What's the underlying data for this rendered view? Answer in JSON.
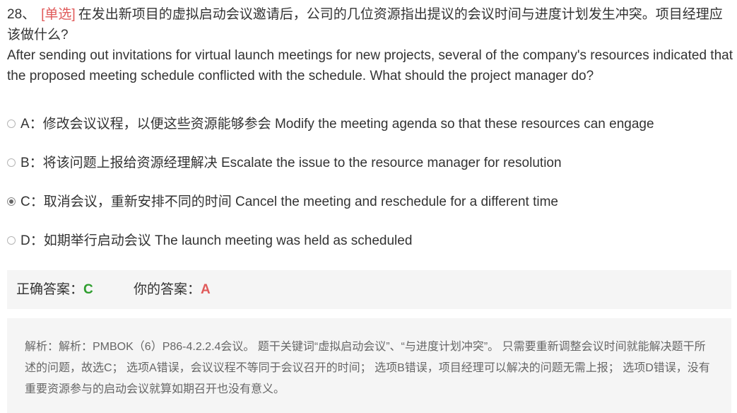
{
  "question": {
    "number": "28、",
    "type": "[单选]",
    "text_cn": "在发出新项目的虚拟启动会议邀请后，公司的几位资源指出提议的会议时间与进度计划发生冲突。项目经理应该做什么?",
    "text_en": "After sending out invitations for virtual launch meetings for new projects, several of the company's resources indicated that the proposed meeting schedule conflicted with the schedule. What should the project manager do?"
  },
  "options": [
    {
      "label": "A：修改会议议程，以便这些资源能够参会 Modify the meeting agenda so that these resources can engage",
      "selected": false
    },
    {
      "label": "B：将该问题上报给资源经理解决 Escalate the issue to the resource manager for resolution",
      "selected": false
    },
    {
      "label": "C：取消会议，重新安排不同的时间 Cancel the meeting and reschedule for a different time",
      "selected": true
    },
    {
      "label": "D：如期举行启动会议 The launch meeting was held as scheduled",
      "selected": false
    }
  ],
  "answer": {
    "correct_label": "正确答案：",
    "correct_value": "C",
    "yours_label": "你的答案：",
    "yours_value": "A"
  },
  "analysis": {
    "text": "解析：解析：PMBOK（6）P86-4.2.2.4会议。 题干关键词“虚拟启动会议”、“与进度计划冲突”。 只需要重新调整会议时间就能解决题干所述的问题，故选C； 选项A错误，会议议程不等同于会议召开的时间； 选项B错误，项目经理可以解决的问题无需上报； 选项D错误，没有重要资源参与的启动会议就算如期召开也没有意义。"
  },
  "colors": {
    "question_type": "#e05a5a",
    "correct": "#2e9e2e",
    "wrong": "#e05a5a",
    "panel_bg": "#f5f5f5"
  }
}
